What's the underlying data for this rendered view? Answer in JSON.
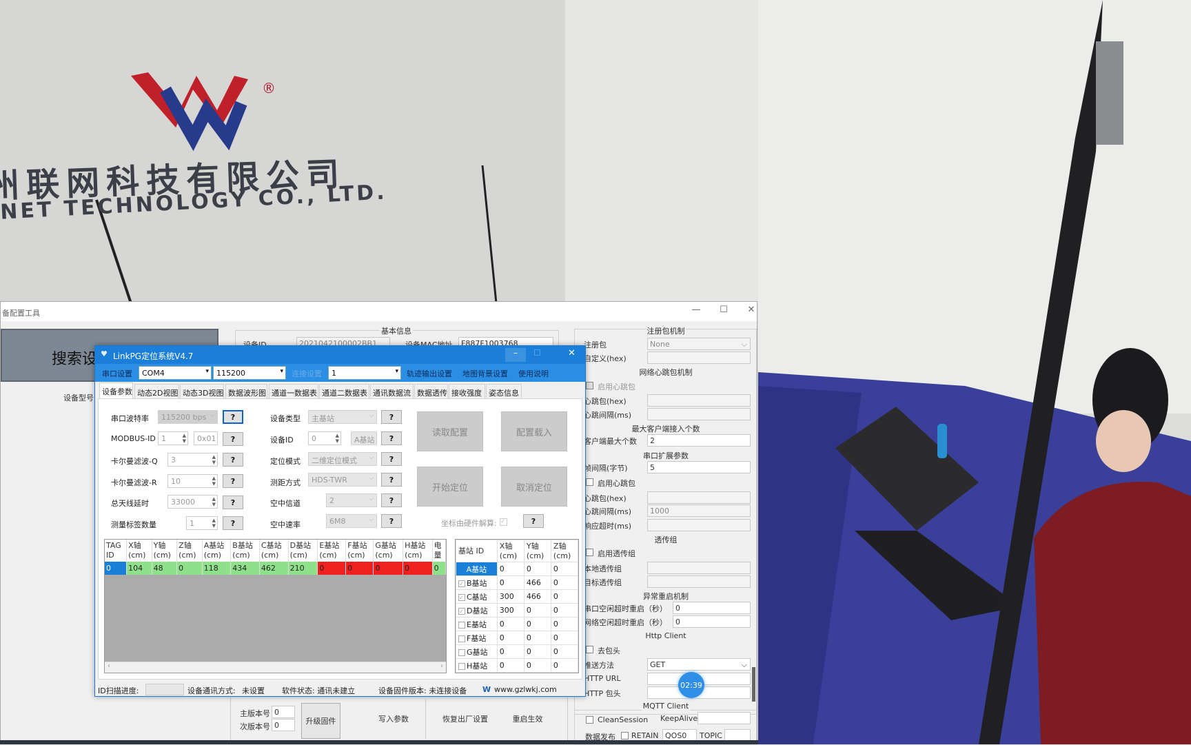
{
  "background": {
    "logo_cn": "州联网科技有限公司",
    "logo_en": "NET TECHNOLOGY CO., LTD.",
    "logo_mark": "®",
    "timer": "02:39"
  },
  "back_window": {
    "title": "备配置工具",
    "search_button": "搜索设",
    "device_model_label": "设备型号",
    "basic_info": {
      "group_title": "基本信息",
      "device_id_label": "设备ID",
      "device_id_value": "2021042100002BB1",
      "mac_label": "设备MAC地址",
      "mac_value": "F887F1003768"
    },
    "right_panel": {
      "reg_group": "注册包机制",
      "reg_label": "注册包",
      "reg_value": "None",
      "custom_hex_label": "自定义(hex)",
      "net_hb_group": "网络心跳包机制",
      "net_hb_enable": "启用心跳包",
      "net_hb_hex": "心跳包(hex)",
      "net_hb_interval": "心跳间隔(ms)",
      "max_client_group": "最大客户端接入个数",
      "max_client_label": "客户端最大个数",
      "max_client_value": "2",
      "serial_ext_group": "串口扩展参数",
      "frame_interval_label": "帧间隔(字节)",
      "frame_interval_value": "5",
      "serial_hb_enable": "启用心跳包",
      "serial_hb_hex": "心跳包(hex)",
      "serial_hb_interval": "心跳间隔(ms)",
      "serial_hb_interval_value": "1000",
      "response_timeout": "响应超时(ms)",
      "passthrough_group": "透传组",
      "passthrough_enable": "启用透传组",
      "local_group": "本地透传组",
      "target_group": "目标透传组",
      "restart_group": "异常重启机制",
      "serial_idle": "串口空闲超时重启（秒）",
      "serial_idle_value": "0",
      "net_idle": "网络空闲超时重启（秒）",
      "net_idle_value": "0",
      "http_group": "Http Client",
      "strip_header": "去包头",
      "push_method_label": "推送方法",
      "push_method_value": "GET",
      "http_url": "HTTP URL",
      "http_header": "HTTP 包头",
      "mqtt_group": "MQTT Client",
      "clean_session": "CleanSession",
      "keepalive": "KeepAlive",
      "publish": "数据发布",
      "retain": "RETAIN",
      "qos": "QOS0",
      "topic": "TOPIC"
    },
    "bottom": {
      "major_label": "主版本号",
      "major_value": "0",
      "minor_label": "次版本号",
      "minor_value": "0",
      "upgrade": "升级固件",
      "write": "写入参数",
      "factory": "恢复出厂设置",
      "restart": "重启生效"
    }
  },
  "front_window": {
    "title": "LinkPG定位系统V4.7",
    "toolbar": {
      "serial_settings": "串口设置",
      "port": "COM4",
      "baud": "115200",
      "conn_settings": "连接设置",
      "conn_value": "1",
      "track_output": "轨迹输出设置",
      "map_bg": "地图背景设置",
      "help": "使用说明"
    },
    "tabs": [
      "设备参数",
      "动态2D视图",
      "动态3D视图",
      "数据波形图",
      "通道一数据表",
      "通道二数据表",
      "通讯数据流",
      "数据透传",
      "接收强度",
      "姿态信息"
    ],
    "form": {
      "baud_label": "串口波特率",
      "baud_value": "115200 bps",
      "modbus_label": "MODBUS-ID",
      "modbus_value": "1",
      "modbus_hex": "0x01",
      "kalman_q_label": "卡尔曼滤波-Q",
      "kalman_q_value": "3",
      "kalman_r_label": "卡尔曼滤波-R",
      "kalman_r_value": "10",
      "antenna_label": "总天线延时",
      "antenna_value": "33000",
      "tag_count_label": "测量标签数量",
      "tag_count_value": "1",
      "dev_type_label": "设备类型",
      "dev_type_value": "主基站",
      "dev_id_label": "设备ID",
      "dev_id_value": "0",
      "dev_id_name": "A基站",
      "pos_mode_label": "定位模式",
      "pos_mode_value": "二维定位模式",
      "range_label": "测距方式",
      "range_value": "HDS-TWR",
      "channel_label": "空中信道",
      "channel_value": "2",
      "rate_label": "空中速率",
      "rate_value": "6M8",
      "hw_solve_label": "坐标由硬件解算:",
      "help": "?",
      "read_config": "读取配置",
      "load_config": "配置载入",
      "start_pos": "开始定位",
      "cancel_pos": "取消定位"
    },
    "tag_table": {
      "headers": [
        [
          "TAG",
          "ID"
        ],
        [
          "X轴",
          "(cm)"
        ],
        [
          "Y轴",
          "(cm)"
        ],
        [
          "Z轴",
          "(cm)"
        ],
        [
          "A基站",
          "(cm)"
        ],
        [
          "B基站",
          "(cm)"
        ],
        [
          "C基站",
          "(cm)"
        ],
        [
          "D基站",
          "(cm)"
        ],
        [
          "E基站",
          "(cm)"
        ],
        [
          "F基站",
          "(cm)"
        ],
        [
          "G基站",
          "(cm)"
        ],
        [
          "H基站",
          "(cm)"
        ],
        [
          "电",
          "量"
        ]
      ],
      "rows": [
        [
          "0",
          "104",
          "48",
          "0",
          "118",
          "434",
          "462",
          "210",
          "0",
          "0",
          "0",
          "0",
          "0"
        ]
      ],
      "colors": {
        "id": "#1a7fd9",
        "ok": "#8fe08a",
        "missing": "#f02020"
      }
    },
    "anchor_table": {
      "headers": [
        [
          "基站  ID",
          ""
        ],
        [
          "X轴",
          "(cm)"
        ],
        [
          "Y轴",
          "(cm)"
        ],
        [
          "Z轴",
          "(cm)"
        ]
      ],
      "rows": [
        {
          "name": "A基站",
          "checked": null,
          "x": "0",
          "y": "0",
          "z": "0"
        },
        {
          "name": "B基站",
          "checked": true,
          "x": "0",
          "y": "466",
          "z": "0"
        },
        {
          "name": "C基站",
          "checked": true,
          "x": "300",
          "y": "466",
          "z": "0"
        },
        {
          "name": "D基站",
          "checked": true,
          "x": "300",
          "y": "0",
          "z": "0"
        },
        {
          "name": "E基站",
          "checked": false,
          "x": "0",
          "y": "0",
          "z": "0"
        },
        {
          "name": "F基站",
          "checked": false,
          "x": "0",
          "y": "0",
          "z": "0"
        },
        {
          "name": "G基站",
          "checked": false,
          "x": "0",
          "y": "0",
          "z": "0"
        },
        {
          "name": "H基站",
          "checked": false,
          "x": "0",
          "y": "0",
          "z": "0"
        }
      ]
    },
    "status": {
      "scan_label": "ID扫描进度:",
      "comm_mode": "设备通讯方式:",
      "comm_value": "未设置",
      "software_state": "软件状态: 通讯未建立",
      "firmware": "设备固件版本: 未连接设备",
      "website": "www.gzlwkj.com"
    }
  }
}
